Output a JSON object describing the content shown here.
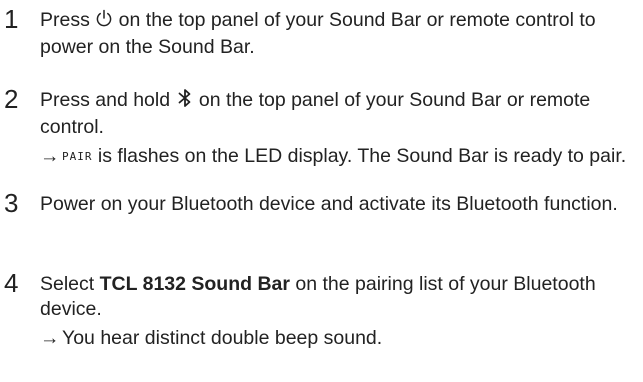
{
  "steps": [
    {
      "number": "1",
      "before_icon": "Press ",
      "icon": "power-icon",
      "after_icon": " on the top panel of your Sound Bar or remote control to power on the Sound Bar."
    },
    {
      "number": "2",
      "before_icon": "Press and hold ",
      "icon": "bluetooth-icon",
      "after_icon": " on the top panel of your Sound Bar or remote control.",
      "result_arrow": "→",
      "result_lcd": "PAIR",
      "result_text": " is flashes on the LED display. The Sound Bar is ready to pair."
    },
    {
      "number": "3",
      "text": "Power on your Bluetooth device and activate its Bluetooth function."
    },
    {
      "number": "4",
      "before_bold": "Select ",
      "bold": "TCL 8132 Sound Bar",
      "after_bold": " on the pairing list of your Bluetooth device.",
      "result_arrow": "→",
      "result_text": "You hear distinct double beep sound."
    }
  ]
}
